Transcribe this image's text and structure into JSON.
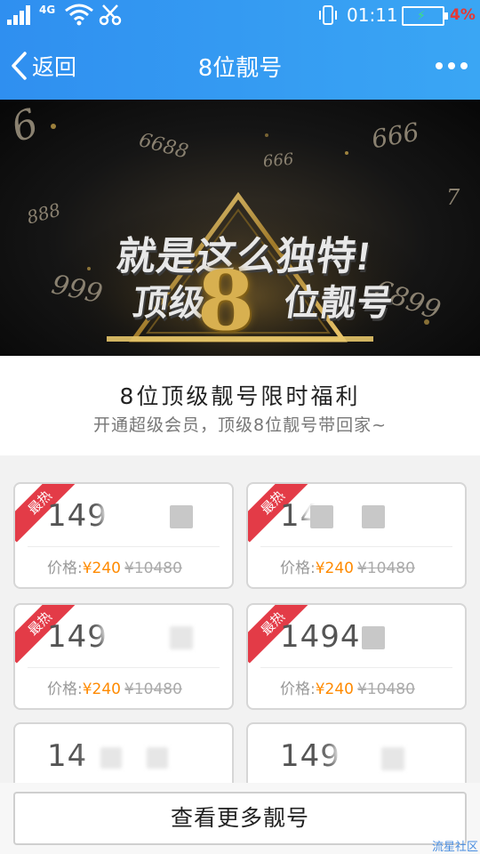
{
  "status_bar": {
    "network": "4G",
    "time": "01:11",
    "battery_percent": "4%",
    "icons": [
      "signal-icon",
      "wifi-icon",
      "scissors-icon",
      "vibrate-icon",
      "battery-charging-icon"
    ]
  },
  "nav": {
    "back_label": "返回",
    "title": "8位靓号",
    "more_icon": "more-dots-icon"
  },
  "banner": {
    "line1": "就是这么独特!",
    "line2_left": "顶级",
    "line2_mid": "8",
    "line2_right": "位靓号",
    "bg_numbers": [
      "6",
      "6688",
      "666",
      "666",
      "888",
      "7",
      "999",
      "6899"
    ]
  },
  "promo": {
    "title": "8位顶级靓号限时福利",
    "subtitle": "开通超级会员，顶级8位靓号带回家~"
  },
  "cards": [
    {
      "hot": "最热",
      "number_visible": "149",
      "price_label": "价格:",
      "price_now": "¥240",
      "price_old": "¥10480"
    },
    {
      "hot": "最热",
      "number_visible": "14",
      "price_label": "价格:",
      "price_now": "¥240",
      "price_old": "¥10480"
    },
    {
      "hot": "最热",
      "number_visible": "149",
      "price_label": "价格:",
      "price_now": "¥240",
      "price_old": "¥10480"
    },
    {
      "hot": "最热",
      "number_visible": "1494",
      "price_label": "价格:",
      "price_now": "¥240",
      "price_old": "¥10480"
    },
    {
      "hot": "",
      "number_visible": "14",
      "price_label": "",
      "price_now": "",
      "price_old": ""
    },
    {
      "hot": "",
      "number_visible": "14",
      "price_label": "",
      "price_now": "",
      "price_old": ""
    }
  ],
  "more_button": "查看更多靓号",
  "watermark": "流星社区",
  "colors": {
    "header_blue": "#2f8ff0",
    "hot_red": "#e33b47",
    "price_orange": "#ff8a00",
    "battery_red": "#e53935"
  }
}
